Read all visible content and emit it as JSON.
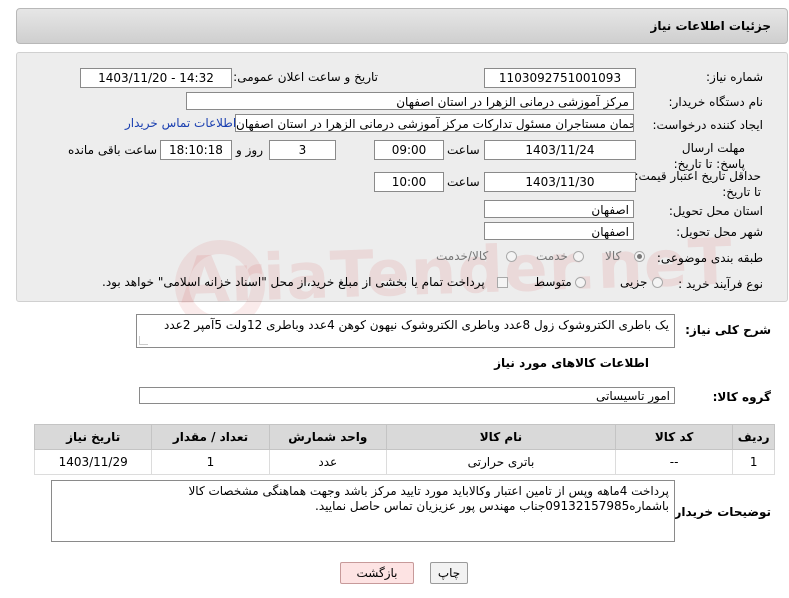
{
  "header": {
    "title": "جزئیات اطلاعات نیاز"
  },
  "form": {
    "need_number_label": "شماره نیاز:",
    "need_number": "1103092751001093",
    "announce_label": "تاریخ و ساعت اعلان عمومی:",
    "announce_value": "1403/11/20 - 14:32",
    "buyer_org_label": "نام دستگاه خریدار:",
    "buyer_org": "مرکز آموزشی درمانی الزهرا در استان اصفهان",
    "requester_label": "ایجاد کننده درخواست:",
    "requester": "رحمان مستاجران مسئول تدارکات مرکز آموزشی درمانی الزهرا در استان اصفهان",
    "contact_link": "اطلاعات تماس خریدار",
    "deadline_label": "مهلت ارسال پاسخ: تا تاریخ:",
    "deadline_date": "1403/11/24",
    "time_label": "ساعت",
    "deadline_time": "09:00",
    "days_value": "3",
    "days_label": "روز و",
    "remaining_time": "18:10:18",
    "remaining_label": "ساعت باقی مانده",
    "min_price_label": "حداقل تاریخ اعتبار قیمت: تا تاریخ:",
    "min_price_date": "1403/11/30",
    "min_price_time": "10:00",
    "province_label": "استان محل تحویل:",
    "province": "اصفهان",
    "city_label": "شهر محل تحویل:",
    "city": "اصفهان",
    "category_label": "طبقه بندی موضوعی:",
    "category_options": [
      "کالا",
      "خدمت",
      "کالا/خدمت"
    ],
    "process_label": "نوع فرآیند خرید :",
    "process_options": [
      "جزیی",
      "متوسط"
    ],
    "payment_text": "پرداخت تمام یا بخشی از مبلغ خرید،از محل \"اسناد خزانه اسلامی\" خواهد بود."
  },
  "description": {
    "label": "شرح کلی نیاز:",
    "text": "یک باطری الکتروشوک زول 8عدد وباطری الکتروشوک نیهون کوهن 4عدد وباطری 12ولت 5آمپر 2عدد"
  },
  "goods": {
    "section_title": "اطلاعات کالاهای مورد نیاز",
    "group_label": "گروه کالا:",
    "group_value": "امور تاسیساتی",
    "columns": [
      "ردیف",
      "کد کالا",
      "نام کالا",
      "واحد شمارش",
      "تعداد / مقدار",
      "تاریخ نیاز"
    ],
    "rows": [
      [
        "1",
        "--",
        "باتری حرارتی",
        "عدد",
        "1",
        "1403/11/29"
      ]
    ]
  },
  "buyer_notes": {
    "label": "توضیحات خریدار:",
    "text": "پرداخت 4ماهه وپس از تامین اعتبار وکالاباید مورد تایید مرکز باشد وجهت هماهنگی مشخصات کالا باشماره09132157985جناب مهندس پور عزیزیان تماس حاصل نمایید."
  },
  "buttons": {
    "print": "چاپ",
    "back": "بازگشت"
  },
  "watermark": "AriaTender.neT"
}
